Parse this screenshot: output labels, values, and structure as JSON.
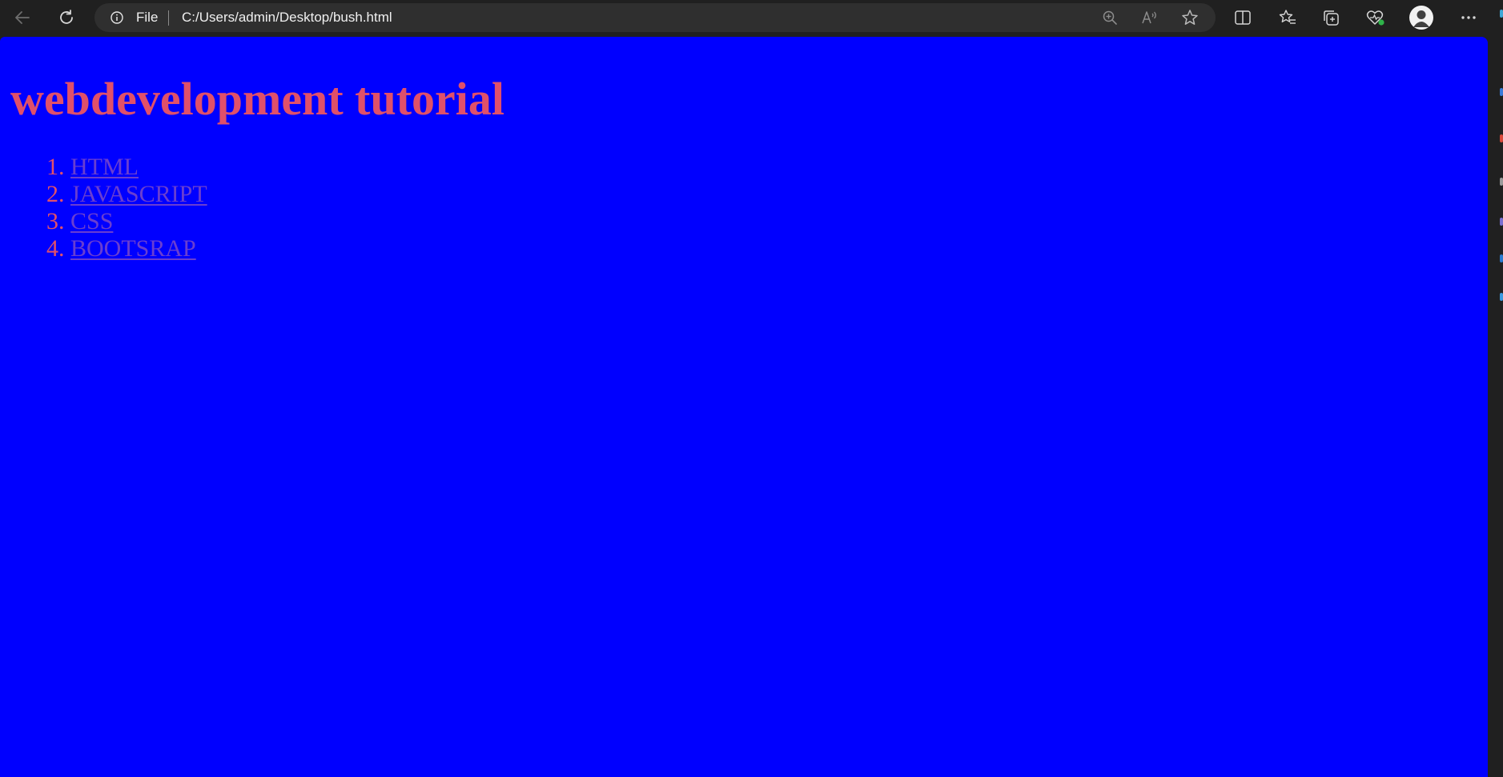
{
  "toolbar": {
    "address_scheme": "File",
    "address_url": "C:/Users/admin/Desktop/bush.html"
  },
  "icons": {
    "back": "back-arrow-icon",
    "reload": "reload-icon",
    "info": "info-icon",
    "zoom": "zoom-in-icon",
    "read_aloud": "read-aloud-icon",
    "favorite": "star-icon",
    "split": "split-screen-icon",
    "favorites": "favorites-list-icon",
    "collections": "collections-icon",
    "health": "browser-essentials-icon",
    "profile": "profile-avatar-icon",
    "more": "more-options-icon"
  },
  "page": {
    "heading": "webdevelopment tutorial",
    "links": [
      {
        "label": "HTML"
      },
      {
        "label": "JAVASCRIPT"
      },
      {
        "label": "CSS"
      },
      {
        "label": "BOOTSRAP"
      }
    ]
  },
  "colors": {
    "page_background": "#0000ff",
    "heading_text": "#e0506a",
    "link_text": "#6a3ed0",
    "browser_chrome": "#202020"
  }
}
